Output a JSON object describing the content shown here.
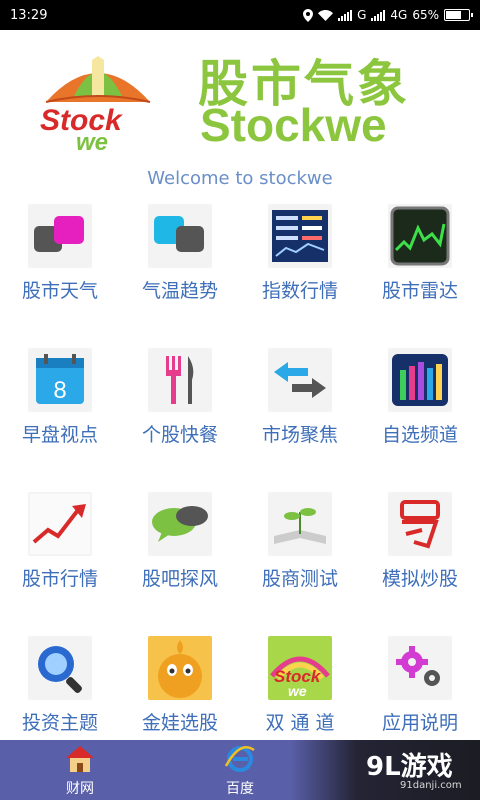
{
  "status_bar": {
    "time": "13:29",
    "network": "G",
    "network2": "4G",
    "battery": "65%"
  },
  "header": {
    "brand_cn": "股市气象",
    "brand_en": "Stockwe",
    "logo_text_top": "Stock",
    "logo_text_bottom": "we",
    "welcome": "Welcome  to stockwe"
  },
  "grid": {
    "items": [
      {
        "label": "股市天气",
        "icon": "weather-icon"
      },
      {
        "label": "气温趋势",
        "icon": "temperature-trend-icon"
      },
      {
        "label": "指数行情",
        "icon": "index-quote-icon"
      },
      {
        "label": "股市雷达",
        "icon": "radar-icon"
      },
      {
        "label": "早盘视点",
        "icon": "calendar-icon"
      },
      {
        "label": "个股快餐",
        "icon": "fork-knife-icon"
      },
      {
        "label": "市场聚焦",
        "icon": "arrows-icon"
      },
      {
        "label": "自选频道",
        "icon": "bars-icon"
      },
      {
        "label": "股市行情",
        "icon": "trend-arrow-icon"
      },
      {
        "label": "股吧探风",
        "icon": "chat-bubbles-icon"
      },
      {
        "label": "股商测试",
        "icon": "book-plant-icon"
      },
      {
        "label": "模拟炒股",
        "icon": "stamp-icon"
      },
      {
        "label": "投资主题",
        "icon": "magnifier-icon"
      },
      {
        "label": "金娃选股",
        "icon": "mascot-icon"
      },
      {
        "label": "双 通 道",
        "icon": "rainbow-logo-icon"
      },
      {
        "label": "应用说明",
        "icon": "gears-icon"
      }
    ]
  },
  "bottom_nav": {
    "items": [
      {
        "label": "财网",
        "icon": "home-icon"
      },
      {
        "label": "百度",
        "icon": "ie-icon"
      }
    ]
  },
  "watermark": {
    "main": "9L游戏",
    "sub": "91danji.com"
  }
}
